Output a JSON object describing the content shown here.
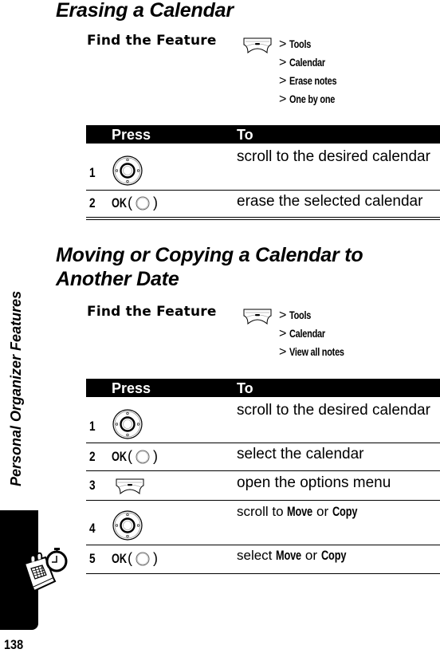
{
  "sidebar": {
    "section_title": "Personal Organizer Features",
    "page_number": "138",
    "icon": "organizer-calendar-stopwatch-icon"
  },
  "sections": [
    {
      "heading": "Erasing a Calendar",
      "find_feature": {
        "label": "Find the Feature",
        "key_icon": "menu-key-icon",
        "path": [
          "Tools",
          "Calendar",
          "Erase notes",
          "One by one"
        ],
        "separator": ">"
      },
      "table": {
        "headers": [
          "Press",
          "To"
        ],
        "rows": [
          {
            "num": "1",
            "press": {
              "type": "nav-key"
            },
            "to": "scroll to the desired calendar"
          },
          {
            "num": "2",
            "press": {
              "type": "ok-key",
              "label": "OK",
              "open": "(",
              "close": ")"
            },
            "to": "erase the selected calendar"
          }
        ]
      }
    },
    {
      "heading": "Moving or Copying a Calendar to Another Date",
      "find_feature": {
        "label": "Find the Feature",
        "key_icon": "menu-key-icon",
        "path": [
          "Tools",
          "Calendar",
          "View all notes"
        ],
        "separator": ">"
      },
      "table": {
        "headers": [
          "Press",
          "To"
        ],
        "rows": [
          {
            "num": "1",
            "press": {
              "type": "nav-key"
            },
            "to": "scroll to the desired calendar"
          },
          {
            "num": "2",
            "press": {
              "type": "ok-key",
              "label": "OK",
              "open": "(",
              "close": ")"
            },
            "to": "select the calendar"
          },
          {
            "num": "3",
            "press": {
              "type": "menu-key"
            },
            "to": "open the options menu"
          },
          {
            "num": "4",
            "press": {
              "type": "nav-key"
            },
            "to_parts": [
              "scroll to ",
              "Move",
              " or ",
              "Copy"
            ]
          },
          {
            "num": "5",
            "press": {
              "type": "ok-key",
              "label": "OK",
              "open": "(",
              "close": ")"
            },
            "to_parts": [
              "select ",
              "Move",
              " or ",
              "Copy"
            ]
          }
        ]
      }
    }
  ]
}
